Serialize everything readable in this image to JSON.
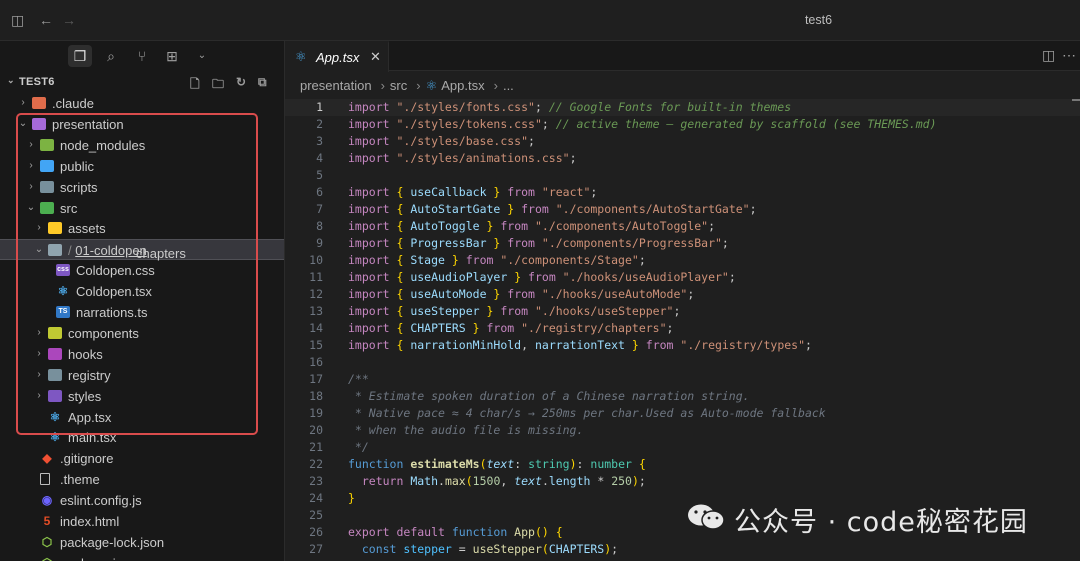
{
  "window": {
    "title": "test6"
  },
  "activity_bar": {
    "items": [
      "explorer",
      "search",
      "source-control",
      "extensions"
    ]
  },
  "explorer": {
    "section_title": "TEST6",
    "tree": [
      {
        "name": ".claude",
        "depth": 0,
        "kind": "folder",
        "state": "closed",
        "color": "#e06c4b"
      },
      {
        "name": "presentation",
        "depth": 0,
        "kind": "folder",
        "state": "open",
        "color": "#a66ad9"
      },
      {
        "name": "node_modules",
        "depth": 1,
        "kind": "folder",
        "state": "closed",
        "color": "#7cb342"
      },
      {
        "name": "public",
        "depth": 1,
        "kind": "folder",
        "state": "closed",
        "color": "#42a5f5"
      },
      {
        "name": "scripts",
        "depth": 1,
        "kind": "folder",
        "state": "closed",
        "color": "#78909c"
      },
      {
        "name": "src",
        "depth": 1,
        "kind": "folder",
        "state": "open",
        "color": "#4caf50"
      },
      {
        "name": "assets",
        "depth": 2,
        "kind": "folder",
        "state": "closed",
        "color": "#ffca28"
      },
      {
        "name": "chapters",
        "name2": "01-coldopen",
        "depth": 2,
        "kind": "folder",
        "state": "open",
        "color": "#90a4ae",
        "selected": true
      },
      {
        "name": "Coldopen.css",
        "depth": 3,
        "kind": "css"
      },
      {
        "name": "Coldopen.tsx",
        "depth": 3,
        "kind": "react"
      },
      {
        "name": "narrations.ts",
        "depth": 3,
        "kind": "ts"
      },
      {
        "name": "components",
        "depth": 2,
        "kind": "folder",
        "state": "closed",
        "color": "#c0ca33"
      },
      {
        "name": "hooks",
        "depth": 2,
        "kind": "folder",
        "state": "closed",
        "color": "#ab47bc"
      },
      {
        "name": "registry",
        "depth": 2,
        "kind": "folder",
        "state": "closed",
        "color": "#78909c"
      },
      {
        "name": "styles",
        "depth": 2,
        "kind": "folder",
        "state": "closed",
        "color": "#7e57c2"
      },
      {
        "name": "App.tsx",
        "depth": 2,
        "kind": "react"
      },
      {
        "name": "main.tsx",
        "depth": 2,
        "kind": "react"
      },
      {
        "name": ".gitignore",
        "depth": 1,
        "kind": "git"
      },
      {
        "name": ".theme",
        "depth": 1,
        "kind": "file"
      },
      {
        "name": "eslint.config.js",
        "depth": 1,
        "kind": "eslint"
      },
      {
        "name": "index.html",
        "depth": 1,
        "kind": "html"
      },
      {
        "name": "package-lock.json",
        "depth": 1,
        "kind": "node"
      },
      {
        "name": "package.json",
        "depth": 1,
        "kind": "node"
      }
    ]
  },
  "editor": {
    "tab_label": "App.tsx",
    "close_glyph": "✕",
    "breadcrumb": [
      "presentation",
      "src",
      "App.tsx",
      "..."
    ],
    "current_line": 1
  },
  "code_lines": [
    [
      [
        "k",
        "import "
      ],
      [
        "s",
        "\"./styles/fonts.css\""
      ],
      [
        "",
        "; "
      ],
      [
        "c",
        "// Google Fonts for built-in themes"
      ]
    ],
    [
      [
        "k",
        "import "
      ],
      [
        "s",
        "\"./styles/tokens.css\""
      ],
      [
        "",
        "; "
      ],
      [
        "c",
        "// active theme — generated by scaffold (see THEMES.md)"
      ]
    ],
    [
      [
        "k",
        "import "
      ],
      [
        "s",
        "\"./styles/base.css\""
      ],
      [
        "",
        ";"
      ]
    ],
    [
      [
        "k",
        "import "
      ],
      [
        "s",
        "\"./styles/animations.css\""
      ],
      [
        "",
        ";"
      ]
    ],
    [],
    [
      [
        "k",
        "import "
      ],
      [
        "b",
        "{ "
      ],
      [
        "v",
        "useCallback"
      ],
      [
        "b",
        " } "
      ],
      [
        "k",
        "from "
      ],
      [
        "s",
        "\"react\""
      ],
      [
        "",
        ";"
      ]
    ],
    [
      [
        "k",
        "import "
      ],
      [
        "b",
        "{ "
      ],
      [
        "v",
        "AutoStartGate"
      ],
      [
        "b",
        " } "
      ],
      [
        "k",
        "from "
      ],
      [
        "s",
        "\"./components/AutoStartGate\""
      ],
      [
        "",
        ";"
      ]
    ],
    [
      [
        "k",
        "import "
      ],
      [
        "b",
        "{ "
      ],
      [
        "v",
        "AutoToggle"
      ],
      [
        "b",
        " } "
      ],
      [
        "k",
        "from "
      ],
      [
        "s",
        "\"./components/AutoToggle\""
      ],
      [
        "",
        ";"
      ]
    ],
    [
      [
        "k",
        "import "
      ],
      [
        "b",
        "{ "
      ],
      [
        "v",
        "ProgressBar"
      ],
      [
        "b",
        " } "
      ],
      [
        "k",
        "from "
      ],
      [
        "s",
        "\"./components/ProgressBar\""
      ],
      [
        "",
        ";"
      ]
    ],
    [
      [
        "k",
        "import "
      ],
      [
        "b",
        "{ "
      ],
      [
        "v",
        "Stage"
      ],
      [
        "b",
        " } "
      ],
      [
        "k",
        "from "
      ],
      [
        "s",
        "\"./components/Stage\""
      ],
      [
        "",
        ";"
      ]
    ],
    [
      [
        "k",
        "import "
      ],
      [
        "b",
        "{ "
      ],
      [
        "v",
        "useAudioPlayer"
      ],
      [
        "b",
        " } "
      ],
      [
        "k",
        "from "
      ],
      [
        "s",
        "\"./hooks/useAudioPlayer\""
      ],
      [
        "",
        ";"
      ]
    ],
    [
      [
        "k",
        "import "
      ],
      [
        "b",
        "{ "
      ],
      [
        "v",
        "useAutoMode"
      ],
      [
        "b",
        " } "
      ],
      [
        "k",
        "from "
      ],
      [
        "s",
        "\"./hooks/useAutoMode\""
      ],
      [
        "",
        ";"
      ]
    ],
    [
      [
        "k",
        "import "
      ],
      [
        "b",
        "{ "
      ],
      [
        "v",
        "useStepper"
      ],
      [
        "b",
        " } "
      ],
      [
        "k",
        "from "
      ],
      [
        "s",
        "\"./hooks/useStepper\""
      ],
      [
        "",
        ";"
      ]
    ],
    [
      [
        "k",
        "import "
      ],
      [
        "b",
        "{ "
      ],
      [
        "v",
        "CHAPTERS"
      ],
      [
        "b",
        " } "
      ],
      [
        "k",
        "from "
      ],
      [
        "s",
        "\"./registry/chapters\""
      ],
      [
        "",
        ";"
      ]
    ],
    [
      [
        "k",
        "import "
      ],
      [
        "b",
        "{ "
      ],
      [
        "v",
        "narrationMinHold"
      ],
      [
        "",
        ", "
      ],
      [
        "v",
        "narrationText"
      ],
      [
        "b",
        " } "
      ],
      [
        "k",
        "from "
      ],
      [
        "s",
        "\"./registry/types\""
      ],
      [
        "",
        ";"
      ]
    ],
    [],
    [
      [
        "cg",
        "/**"
      ]
    ],
    [
      [
        "cg",
        " * Estimate spoken duration of a Chinese narration string."
      ]
    ],
    [
      [
        "cg",
        " * Native pace ≈ 4 char/s → 250ms per char. Used as Auto-mode fallback"
      ]
    ],
    [
      [
        "cg",
        " * when the audio file is missing."
      ]
    ],
    [
      [
        "cg",
        " */"
      ]
    ],
    [
      [
        "kb",
        "function "
      ],
      [
        "fb",
        "estimateMs"
      ],
      [
        "b",
        "("
      ],
      [
        "p",
        "text"
      ],
      [
        "",
        ": "
      ],
      [
        "t",
        "string"
      ],
      [
        "b",
        ")"
      ],
      [
        "",
        ": "
      ],
      [
        "t",
        "number"
      ],
      [
        "b",
        " {"
      ]
    ],
    [
      [
        "",
        ""
      ],
      [
        "k",
        "  return "
      ],
      [
        "v",
        "Math"
      ],
      [
        "",
        ". "
      ],
      [
        "f",
        "max"
      ],
      [
        "b",
        "("
      ],
      [
        "n",
        "1500"
      ],
      [
        "",
        ", "
      ],
      [
        "p",
        "text"
      ],
      [
        "",
        ". "
      ],
      [
        "v",
        "length"
      ],
      [
        "",
        " * "
      ],
      [
        "n",
        "250"
      ],
      [
        "b",
        ")"
      ],
      [
        "",
        ";"
      ]
    ],
    [
      [
        "b",
        "}"
      ]
    ],
    [],
    [
      [
        "k",
        "export "
      ],
      [
        "k",
        "default "
      ],
      [
        "kb",
        "function "
      ],
      [
        "f",
        "App"
      ],
      [
        "b",
        "() {"
      ]
    ],
    [
      [
        "kb",
        "  const "
      ],
      [
        "cn",
        "stepper"
      ],
      [
        "",
        " = "
      ],
      [
        "f",
        "useStepper"
      ],
      [
        "b",
        "("
      ],
      [
        "v",
        "CHAPTERS"
      ],
      [
        "b",
        ")"
      ],
      [
        "",
        ";"
      ]
    ]
  ],
  "watermark": {
    "text": "公众号 · code秘密花园"
  }
}
